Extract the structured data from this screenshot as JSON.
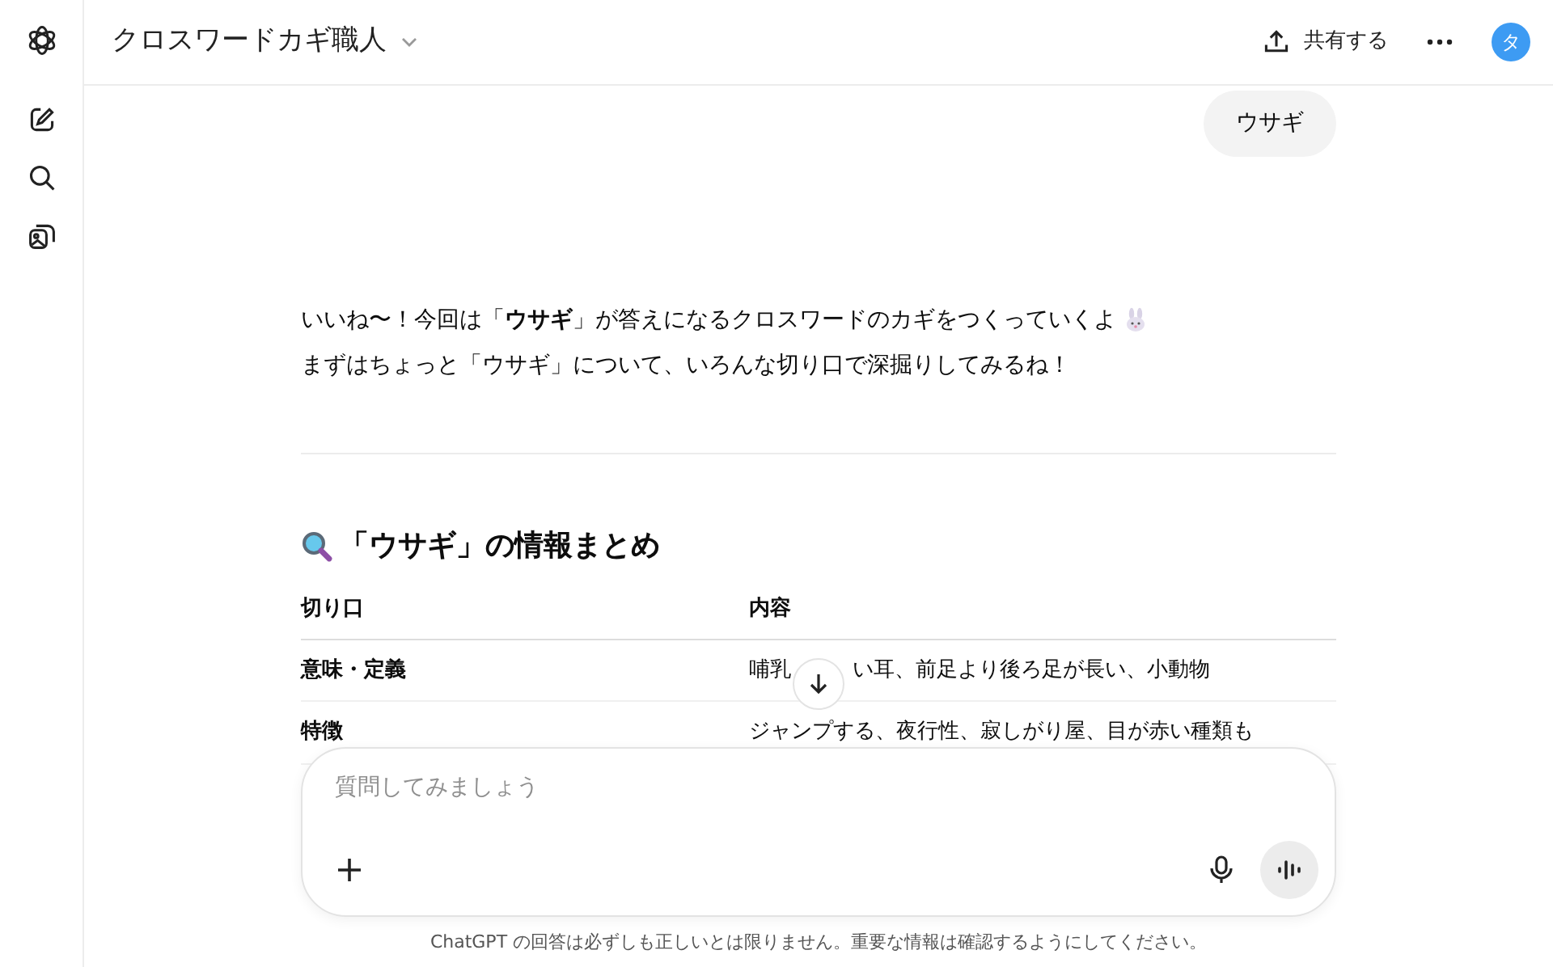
{
  "header": {
    "title": "クロスワードカギ職人",
    "share_label": "共有する",
    "avatar_initial": "タ"
  },
  "user_message": "ウサギ",
  "assistant": {
    "lines": [
      "いいね〜！今回は「**ウサギ**」が答えになるクロスワードのカギをつくっていくよ",
      "まずはちょっと「ウサギ」について、いろんな切り口で深掘りしてみるね！"
    ],
    "heading": "「ウサギ」の情報まとめ",
    "table": {
      "columns": [
        "切り口",
        "内容"
      ],
      "rows": [
        [
          "意味・定義",
          [
            "哺乳",
            "い耳、前足より後ろ足が長い、小動物"
          ]
        ],
        [
          "特徴",
          "ジャンプする、夜行性、寂しがり屋、目が赤い種類も"
        ]
      ]
    }
  },
  "composer": {
    "placeholder": "質問してみましょう"
  },
  "disclaimer": "ChatGPT の回答は必ずしも正しいとは限りません。重要な情報は確認するようにしてください。"
}
